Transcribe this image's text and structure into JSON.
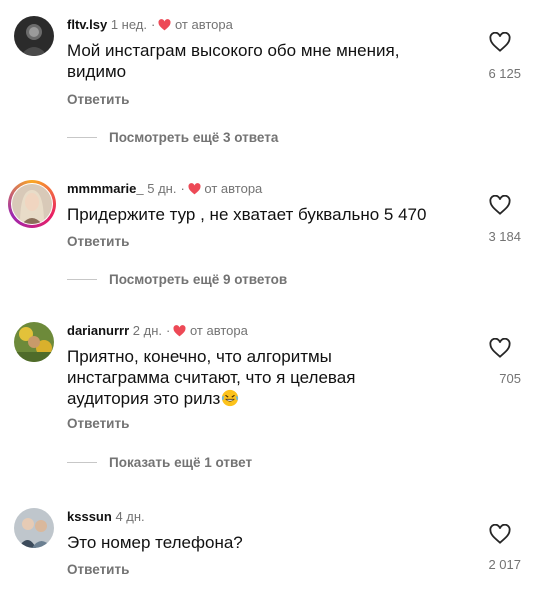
{
  "comments": [
    {
      "username": "fltv.lsy",
      "time": "1 нед.",
      "author_liked": "от автора",
      "text": "Мой инстаграм высокого обо мне мнения, видимо",
      "reply_label": "Ответить",
      "likes": "6 125",
      "view_replies": "Посмотреть ещё 3 ответа"
    },
    {
      "username": "mmmmarie_",
      "time": "5 дн.",
      "author_liked": "от автора",
      "text": "Придержите тур , не хватает буквально 5 470",
      "reply_label": "Ответить",
      "likes": "3 184",
      "view_replies": "Посмотреть ещё 9 ответов"
    },
    {
      "username": "darianurrr",
      "time": "2 дн.",
      "author_liked": "от автора",
      "text": "Приятно, конечно, что алгоритмы инстаграмма считают, что я целевая аудитория это рилз",
      "emoji": "rofl-emoji",
      "reply_label": "Ответить",
      "likes": "705",
      "view_replies": "Показать ещё 1 ответ"
    },
    {
      "username": "ksssun",
      "time": "4 дн.",
      "text": "Это номер телефона?",
      "reply_label": "Ответить",
      "likes": "2 017"
    }
  ],
  "colors": {
    "text": "#111111",
    "secondary": "#737373",
    "heart_red": "#ed4956"
  },
  "icons": {
    "like": "heart-outline-icon",
    "author_like": "heart-filled-icon"
  }
}
